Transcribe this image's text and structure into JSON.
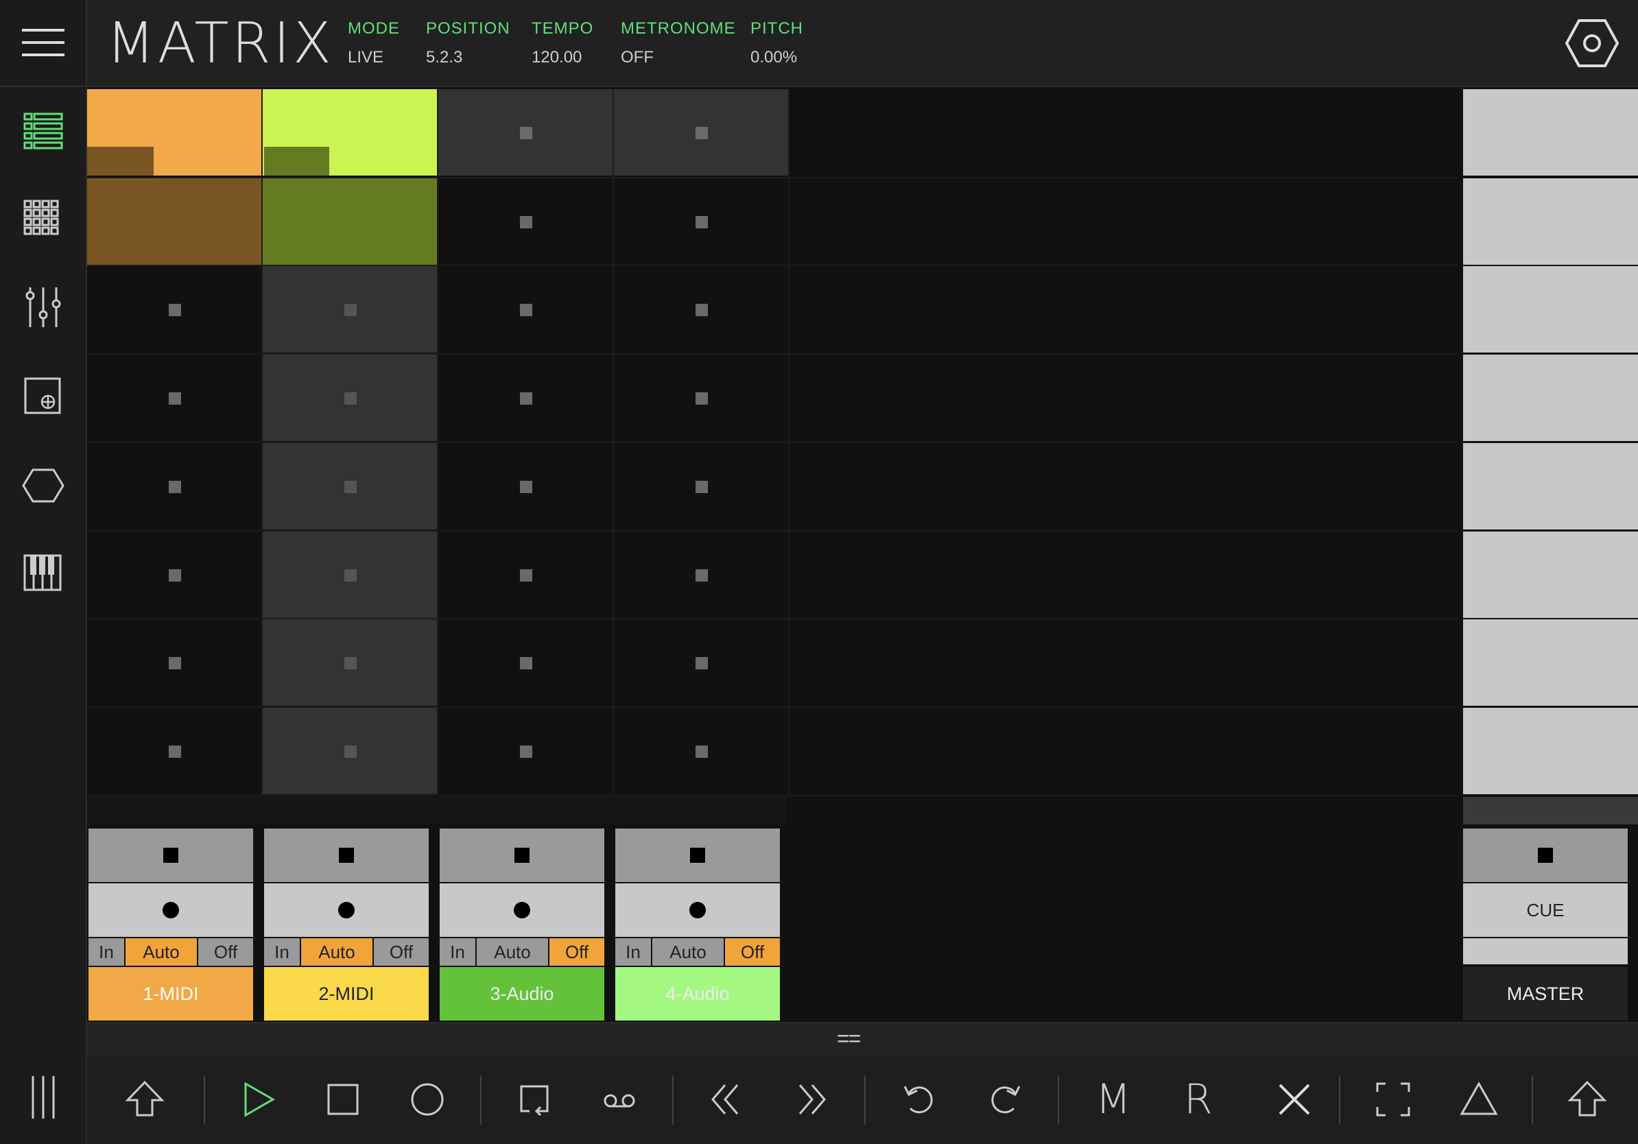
{
  "header": {
    "app_title": "MATRIX",
    "fields": [
      {
        "label": "MODE",
        "value": "LIVE"
      },
      {
        "label": "POSITION",
        "value": "5.2.3"
      },
      {
        "label": "TEMPO",
        "value": "120.00"
      },
      {
        "label": "METRONOME",
        "value": "OFF"
      },
      {
        "label": "PITCH",
        "value": "0.00%"
      }
    ]
  },
  "sidebar": {
    "items": [
      "clip-list-icon",
      "pad-grid-icon",
      "mixer-icon",
      "device-add-icon",
      "hexagon-icon",
      "piano-icon",
      "columns-icon"
    ]
  },
  "tracks": [
    {
      "name": "1-MIDI",
      "color": "#f0a946",
      "monitor": [
        "In",
        "Auto",
        "Off"
      ],
      "monitor_active": "Auto"
    },
    {
      "name": "2-MIDI",
      "color": "#fad94b",
      "monitor": [
        "In",
        "Auto",
        "Off"
      ],
      "monitor_active": "Auto"
    },
    {
      "name": "3-Audio",
      "color": "#63c23a",
      "monitor": [
        "In",
        "Auto",
        "Off"
      ],
      "monitor_active": "Off"
    },
    {
      "name": "4-Audio",
      "color": "#a4f882",
      "monitor": [
        "In",
        "Auto",
        "Off"
      ],
      "monitor_active": "Off"
    }
  ],
  "master": {
    "cue_label": "CUE",
    "name": "MASTER"
  },
  "clips": {
    "track1_scene1_color": "#f2a94a",
    "track2_scene1_color": "#cbf452",
    "track1_scene2_color": "#7a5524",
    "track2_scene2_color": "#657b22",
    "track1_scene1_progress": 0.38,
    "track2_scene1_progress": 0.38
  },
  "toolbar": {
    "divider_glyph": "==",
    "buttons": [
      "shift-icon",
      "play-icon",
      "stop-icon",
      "record-icon",
      "loop-icon",
      "overdub-icon",
      "rewind-icon",
      "forward-icon",
      "undo-icon",
      "redo-icon",
      "mute-icon",
      "record-arm-icon",
      "delete-icon",
      "fullscreen-icon",
      "triangle-icon",
      "shift-icon"
    ],
    "m_label": "M",
    "r_label": "R"
  },
  "colors": {
    "accent": "#5fe07a"
  }
}
